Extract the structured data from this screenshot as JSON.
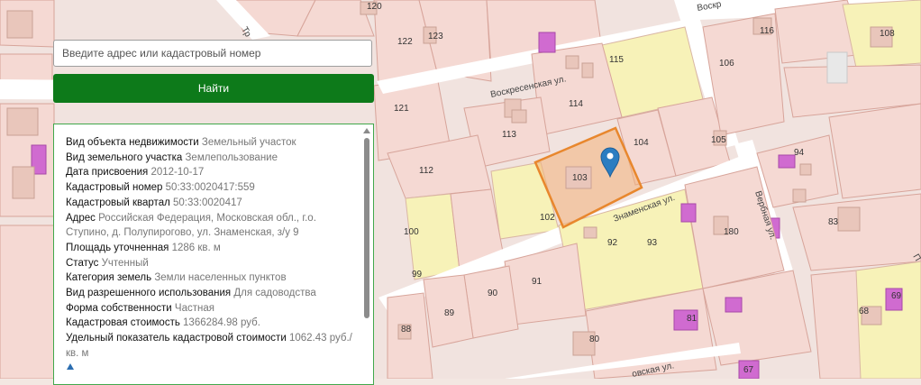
{
  "search": {
    "placeholder": "Введите адрес или кадастровый номер",
    "button_label": "Найти"
  },
  "info_panel": {
    "rows": [
      {
        "key": "Вид объекта недвижимости",
        "value": "Земельный участок"
      },
      {
        "key": "Вид земельного участка",
        "value": "Землепользование"
      },
      {
        "key": "Дата присвоения",
        "value": "2012-10-17"
      },
      {
        "key": "Кадастровый номер",
        "value": "50:33:0020417:559"
      },
      {
        "key": "Кадастровый квартал",
        "value": "50:33:0020417"
      },
      {
        "key": "Адрес",
        "value": "Российская Федерация, Московская обл., г.о. Ступино, д. Полупирогово, ул. Знаменская, з/у 9"
      },
      {
        "key": "Площадь уточненная",
        "value": "1286 кв. м"
      },
      {
        "key": "Статус",
        "value": "Учтенный"
      },
      {
        "key": "Категория земель",
        "value": "Земли населенных пунктов"
      },
      {
        "key": "Вид разрешенного использования",
        "value": "Для садоводства"
      },
      {
        "key": "Форма собственности",
        "value": "Частная"
      },
      {
        "key": "Кадастровая стоимость",
        "value": "1366284.98 руб."
      },
      {
        "key": "Удельный показатель кадастровой стоимости",
        "value": "1062.43 руб./кв. м"
      }
    ]
  },
  "map": {
    "streets": {
      "voskresenskaya": "Воскресенская ул.",
      "voskr_top": "Воскр",
      "znamenskaya": "Знаменская ул.",
      "vernaya": "Вербная ул.",
      "bottom_street": "овская ул.",
      "top_left_street": "Тр",
      "right_edge": "П"
    },
    "parcels": [
      "120",
      "122",
      "123",
      "115",
      "116",
      "106",
      "108",
      "121",
      "114",
      "113",
      "104",
      "105",
      "112",
      "103",
      "102",
      "94",
      "100",
      "99",
      "92",
      "93",
      "180",
      "83",
      "91",
      "90",
      "89",
      "88",
      "80",
      "81",
      "68",
      "69",
      "67"
    ],
    "selected_parcel": "103",
    "marker_icon": "map-pin-icon"
  }
}
